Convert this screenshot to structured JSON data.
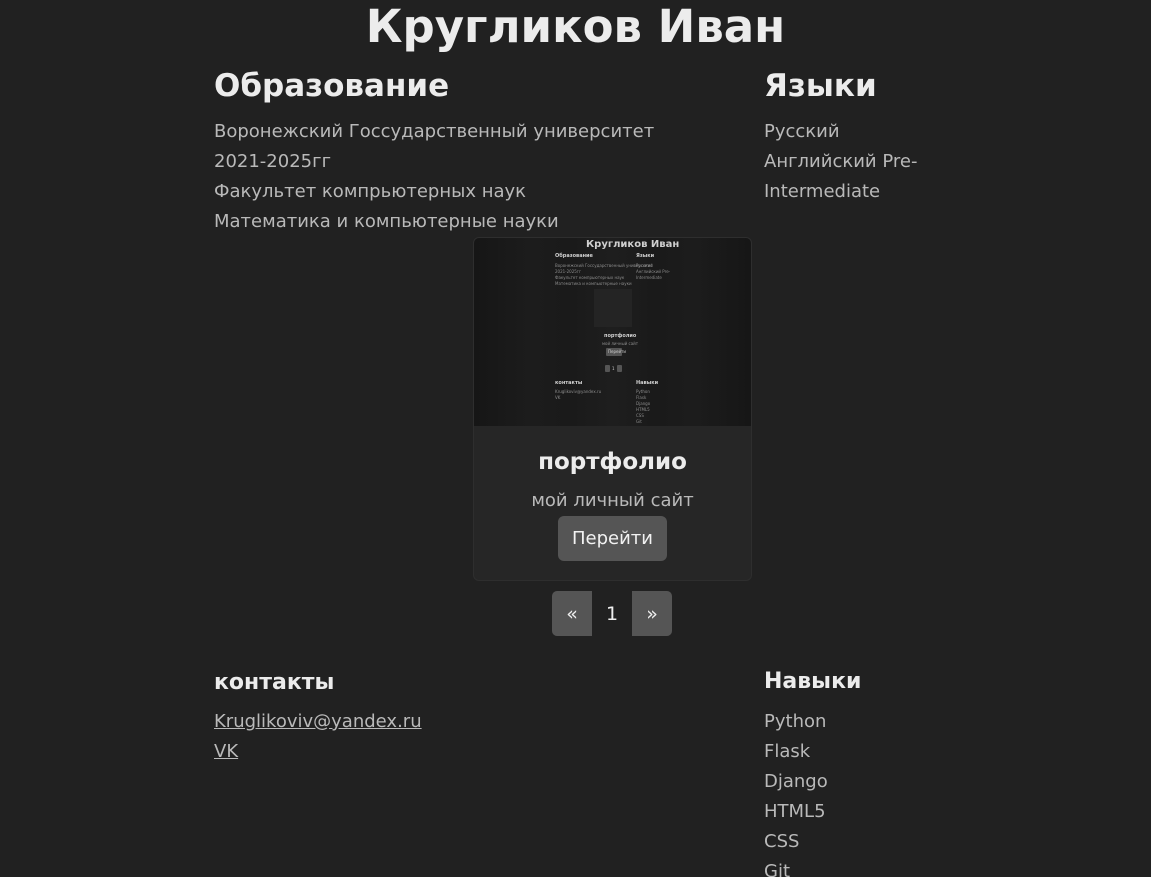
{
  "header": {
    "name": "Кругликов Иван"
  },
  "education": {
    "title": "Образование",
    "items": [
      "Воронежский Госсударственный университет",
      "2021-2025гг",
      "Факультет компрьютерных наук",
      "Математика и компьютерные науки"
    ]
  },
  "languages": {
    "title": "Языки",
    "items": [
      "Русский",
      "Английский Pre-Intermediate"
    ]
  },
  "project": {
    "thumbnail": {
      "name": "Кругликов Иван",
      "edu_title": "Образование",
      "lang_title": "Языки",
      "edu_lines": [
        "Воронежский Госсударственный университет",
        "2021-2025гг",
        "Факультет компрьютерных наук",
        "Математика и компьютерные науки"
      ],
      "lang_lines": [
        "Русский",
        "Английский Pre-",
        "Intermediate"
      ],
      "card_title": "портфолио",
      "card_desc": "мой личный сайт",
      "card_button": "Перейти",
      "contacts_title": "контакты",
      "contacts_lines": [
        "Kruglikoviv@yandex.ru",
        "VK"
      ],
      "skills_title": "Навыки",
      "skills_lines": [
        "Python",
        "Flask",
        "Django",
        "HTML5",
        "CSS",
        "Git"
      ]
    },
    "title": "портфолио",
    "description": "мой личный сайт",
    "button_label": "Перейти"
  },
  "pagination": {
    "prev": "«",
    "current": "1",
    "next": "»"
  },
  "contacts": {
    "title": "контакты",
    "items": [
      "Kruglikoviv@yandex.ru",
      "VK"
    ]
  },
  "skills": {
    "title": "Навыки",
    "items": [
      "Python",
      "Flask",
      "Django",
      "HTML5",
      "CSS",
      "Git"
    ]
  }
}
